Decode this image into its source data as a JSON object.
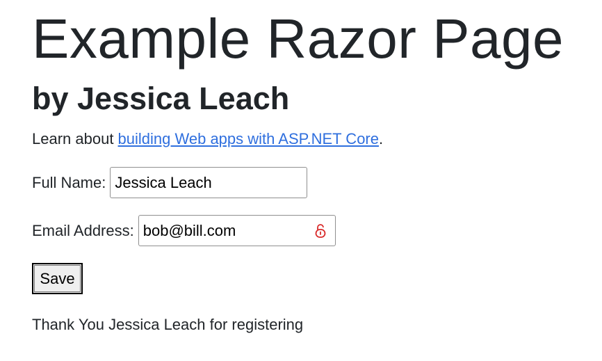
{
  "page": {
    "title": "Example Razor Page",
    "subtitle": "by Jessica Leach"
  },
  "intro": {
    "prefix": "Learn about ",
    "link_text": "building Web apps with ASP.NET Core",
    "suffix": "."
  },
  "form": {
    "full_name": {
      "label": "Full Name:",
      "value": "Jessica Leach"
    },
    "email": {
      "label": "Email Address:",
      "value": "bob@bill.com",
      "icon": "lock-open-icon",
      "icon_color": "#d92b2b"
    },
    "save_label": "Save"
  },
  "message": {
    "thanks": "Thank You Jessica Leach for registering"
  },
  "colors": {
    "text": "#212529",
    "link": "#2f6fde"
  }
}
